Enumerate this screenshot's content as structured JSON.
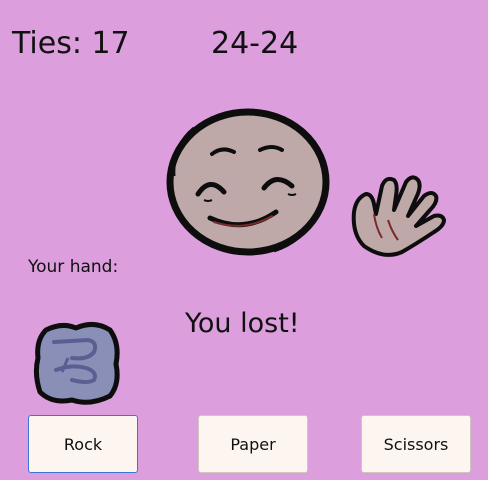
{
  "header": {
    "ties_text": "Ties: 17",
    "score_text": "24-24"
  },
  "labels": {
    "your_hand": "Your hand:"
  },
  "result": {
    "text": "You lost!"
  },
  "opponent": {
    "face_icon": "smiling-face-icon",
    "hand_icon": "open-hand-paper-icon"
  },
  "player": {
    "hand_icon": "rock-icon"
  },
  "buttons": {
    "rock": "Rock",
    "paper": "Paper",
    "scissors": "Scissors"
  },
  "colors": {
    "background": "#dc9edc",
    "button_background": "#fdf5ef",
    "focused_border": "#3a76d6",
    "face_fill": "#bfa8a8",
    "rock_fill": "#8a8fb8"
  }
}
